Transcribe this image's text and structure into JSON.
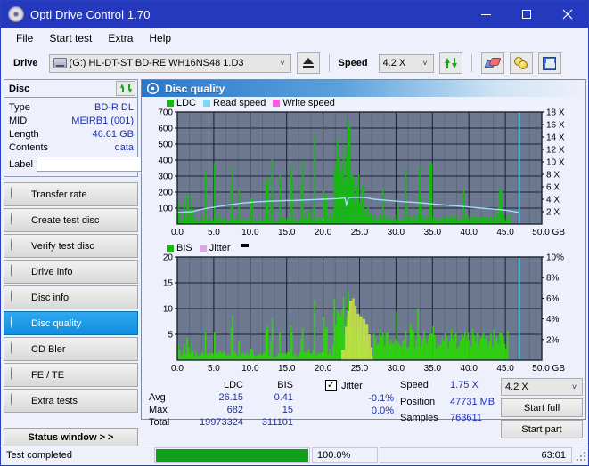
{
  "window": {
    "title": "Opti Drive Control 1.70",
    "icon": "disc-icon",
    "minimize_label": "–",
    "maximize_label": "□",
    "close_label": "×"
  },
  "menubar": {
    "items": [
      {
        "label": "File"
      },
      {
        "label": "Start test"
      },
      {
        "label": "Extra"
      },
      {
        "label": "Help"
      }
    ]
  },
  "toolbar": {
    "drive_label": "Drive",
    "drive_value": "(G:)  HL-DT-ST BD-RE  WH16NS48 1.D3",
    "eject_icon": "eject-icon",
    "speed_label": "Speed",
    "speed_value": "4.2 X",
    "refresh_icon": "refresh-icon",
    "erase_icon": "eraser-icon",
    "coins_icon": "coins-icon",
    "save_icon": "save-icon",
    "chevron": "˅"
  },
  "disc_panel": {
    "title": "Disc",
    "refresh_icon": "refresh-icon",
    "rows": [
      {
        "key": "Type",
        "value": "BD-R DL"
      },
      {
        "key": "MID",
        "value": "MEIRB1 (001)"
      },
      {
        "key": "Length",
        "value": "46.61 GB"
      },
      {
        "key": "Contents",
        "value": "data"
      }
    ],
    "label_key": "Label",
    "label_value": "",
    "label_placeholder": "",
    "label_button_icon": "disc-icon"
  },
  "sidebar": {
    "items": [
      {
        "label": "Transfer rate",
        "icon": "disc-icon",
        "selected": false
      },
      {
        "label": "Create test disc",
        "icon": "disc-icon",
        "selected": false
      },
      {
        "label": "Verify test disc",
        "icon": "disc-icon",
        "selected": false
      },
      {
        "label": "Drive info",
        "icon": "disc-icon",
        "selected": false
      },
      {
        "label": "Disc info",
        "icon": "disc-icon",
        "selected": false
      },
      {
        "label": "Disc quality",
        "icon": "disc-icon",
        "selected": true
      },
      {
        "label": "CD Bler",
        "icon": "disc-icon",
        "selected": false
      },
      {
        "label": "FE / TE",
        "icon": "disc-icon",
        "selected": false
      },
      {
        "label": "Extra tests",
        "icon": "disc-icon",
        "selected": false
      }
    ],
    "status_window_label": "Status window > >"
  },
  "panel": {
    "title": "Disc quality",
    "icon": "disc-icon"
  },
  "stats": {
    "col_headers": [
      "LDC",
      "BIS"
    ],
    "rows": [
      {
        "label": "Avg",
        "ldc": "26.15",
        "bis": "0.41",
        "jitter": "-0.1%"
      },
      {
        "label": "Max",
        "ldc": "682",
        "bis": "15",
        "jitter": "0.0%"
      },
      {
        "label": "Total",
        "ldc": "19973324",
        "bis": "311101",
        "jitter": ""
      }
    ],
    "jitter_label": "Jitter",
    "jitter_checked": true,
    "jitter_check_glyph": "✓",
    "speed_label": "Speed",
    "speed_value": "1.75 X",
    "position_label": "Position",
    "position_value": "47731 MB",
    "samples_label": "Samples",
    "samples_value": "763611",
    "speed_select_value": "4.2 X",
    "start_full_label": "Start full",
    "start_part_label": "Start part"
  },
  "statusbar": {
    "message": "Test completed",
    "progress_percent": 100.0,
    "progress_text": "100.0%",
    "elapsed": "63:01"
  },
  "chart_data": [
    {
      "type": "area",
      "name": "ldc-chart",
      "title": "Disc quality",
      "xlabel": "GB",
      "ylabel": "",
      "xlim": [
        0,
        50
      ],
      "ylim": [
        0,
        700
      ],
      "y2lim": [
        0,
        18
      ],
      "y2label": "X",
      "xticks": [
        "0.0",
        "5.0",
        "10.0",
        "15.0",
        "20.0",
        "25.0",
        "30.0",
        "35.0",
        "40.0",
        "45.0",
        "50.0 GB"
      ],
      "yticks": [
        100,
        200,
        300,
        400,
        500,
        600,
        700
      ],
      "y2ticks": [
        "2 X",
        "4 X",
        "6 X",
        "8 X",
        "10 X",
        "12 X",
        "14 X",
        "16 X",
        "18 X"
      ],
      "grid": true,
      "legend": [
        {
          "name": "LDC",
          "color": "#17b814"
        },
        {
          "name": "Read speed",
          "color": "#7fd6f5"
        },
        {
          "name": "Write speed",
          "color": "#ff5ce0"
        }
      ],
      "plot_bg": "#6d7991",
      "data_end_gb": 46.9,
      "series": [
        {
          "name": "LDC",
          "color": "#17b814",
          "x": [
            0.0,
            0.3,
            0.6,
            0.9,
            1.2,
            1.5,
            1.8,
            2.1,
            2.4,
            2.7,
            3.0,
            3.3,
            3.6,
            3.9,
            4.2,
            4.5,
            4.8,
            5.1,
            5.4,
            5.7,
            6.0,
            6.3,
            6.6,
            6.9,
            7.2,
            7.5,
            7.8,
            8.1,
            8.4,
            8.7,
            9.0,
            9.3,
            9.6,
            9.9,
            10.2,
            10.5,
            10.8,
            11.1,
            11.4,
            11.7,
            12.0,
            12.3,
            12.6,
            12.9,
            13.2,
            13.5,
            13.8,
            14.1,
            14.4,
            14.7,
            15.0,
            15.3,
            15.6,
            15.9,
            16.2,
            16.5,
            16.8,
            17.1,
            17.4,
            17.7,
            18.0,
            18.3,
            18.6,
            18.9,
            19.2,
            19.5,
            19.8,
            20.1,
            20.4,
            20.7,
            21.0,
            21.3,
            21.6,
            21.9,
            22.2,
            22.5,
            22.8,
            23.1,
            23.4,
            23.7,
            24.0,
            24.3,
            24.6,
            24.9,
            25.2,
            25.5,
            25.8,
            26.1,
            26.4,
            26.7,
            27.0,
            27.3,
            27.6,
            27.9,
            28.2,
            28.5,
            28.8,
            29.1,
            29.4,
            29.7,
            30.0,
            30.3,
            30.6,
            30.9,
            31.2,
            31.5,
            31.8,
            32.1,
            32.4,
            32.7,
            33.0,
            33.3,
            33.6,
            33.9,
            34.2,
            34.5,
            34.8,
            35.1,
            35.4,
            35.7,
            36.0,
            36.3,
            36.6,
            36.9,
            37.2,
            37.5,
            37.8,
            38.1,
            38.4,
            38.7,
            39.0,
            39.3,
            39.6,
            39.9,
            40.2,
            40.5,
            40.8,
            41.1,
            41.4,
            41.7,
            42.0,
            42.3,
            42.6,
            42.9,
            43.2,
            43.5,
            43.8,
            44.1,
            44.4,
            44.7,
            45.0,
            45.3,
            45.6,
            45.9,
            46.2,
            46.5,
            46.8
          ],
          "y": [
            400,
            70,
            40,
            240,
            60,
            230,
            55,
            250,
            45,
            30,
            35,
            40,
            30,
            390,
            45,
            30,
            25,
            385,
            40,
            60,
            30,
            35,
            45,
            30,
            40,
            330,
            35,
            45,
            330,
            30,
            40,
            45,
            30,
            55,
            360,
            50,
            35,
            40,
            30,
            45,
            30,
            300,
            50,
            420,
            40,
            35,
            30,
            330,
            45,
            55,
            40,
            30,
            385,
            45,
            30,
            40,
            35,
            385,
            30,
            45,
            120,
            40,
            250,
            580,
            40,
            50,
            35,
            200,
            170,
            45,
            80,
            90,
            330,
            520,
            690,
            420,
            470,
            530,
            610,
            560,
            420,
            350,
            300,
            280,
            250,
            230,
            200,
            130,
            90,
            70,
            60,
            55,
            50,
            45,
            230,
            50,
            40,
            45,
            50,
            40,
            45,
            200,
            40,
            35,
            50,
            340,
            45,
            40,
            50,
            35,
            60,
            420,
            55,
            45,
            40,
            60,
            420,
            45,
            35,
            40,
            50,
            45,
            40,
            60,
            45,
            40,
            35,
            50,
            45,
            60,
            40,
            280,
            50,
            45,
            40,
            35,
            55,
            45,
            50,
            40,
            45,
            60,
            50,
            45,
            40,
            35,
            130,
            200,
            230,
            90,
            60,
            45,
            70
          ]
        },
        {
          "name": "Read speed",
          "color": "#9fdcf7",
          "x": [
            0.0,
            1.0,
            2.0,
            3.0,
            4.0,
            5.0,
            6.0,
            7.0,
            8.0,
            9.0,
            10.0,
            11.0,
            12.0,
            13.0,
            14.0,
            15.0,
            16.0,
            17.0,
            18.0,
            19.0,
            20.0,
            21.0,
            22.0,
            23.0,
            23.2,
            23.5,
            24.0,
            25.0,
            26.0,
            26.5,
            27.0,
            28.0,
            29.0,
            30.0,
            31.0,
            32.0,
            33.0,
            34.0,
            35.0,
            36.0,
            37.0,
            38.0,
            39.0,
            40.0,
            41.0,
            42.0,
            43.0,
            44.0,
            45.0,
            46.0,
            46.9
          ],
          "y": [
            1.85,
            1.95,
            2.0,
            2.3,
            2.55,
            2.7,
            2.9,
            3.1,
            3.25,
            3.4,
            3.5,
            3.6,
            3.65,
            3.7,
            3.75,
            3.8,
            3.8,
            3.85,
            3.9,
            3.95,
            4.0,
            4.05,
            4.1,
            4.2,
            3.1,
            4.25,
            4.3,
            4.3,
            4.25,
            4.1,
            4.0,
            3.9,
            3.8,
            3.7,
            3.6,
            3.55,
            3.45,
            3.35,
            3.25,
            3.15,
            3.05,
            2.95,
            2.85,
            2.75,
            2.65,
            2.55,
            2.45,
            2.35,
            2.25,
            2.05,
            1.9
          ]
        }
      ],
      "cursor_gb": 46.9,
      "cursor_color": "#46d9f0"
    },
    {
      "type": "area",
      "name": "bis-chart",
      "title": "",
      "xlabel": "GB",
      "ylabel": "",
      "xlim": [
        0,
        50
      ],
      "ylim": [
        0,
        20
      ],
      "y2lim": [
        0,
        10
      ],
      "y2label": "%",
      "xticks": [
        "0.0",
        "5.0",
        "10.0",
        "15.0",
        "20.0",
        "25.0",
        "30.0",
        "35.0",
        "40.0",
        "45.0",
        "50.0 GB"
      ],
      "yticks": [
        5,
        10,
        15,
        20
      ],
      "y2ticks": [
        "2%",
        "4%",
        "6%",
        "8%",
        "10%"
      ],
      "grid": true,
      "legend": [
        {
          "name": "BIS",
          "color": "#17b814"
        },
        {
          "name": "Jitter",
          "color": "#d9a8e0"
        }
      ],
      "plot_bg": "#6d7991",
      "data_end_gb": 46.9,
      "series": [
        {
          "name": "BIS",
          "color": "#2fd010",
          "x": [
            0.0,
            0.3,
            0.6,
            0.9,
            1.2,
            1.5,
            1.8,
            2.1,
            2.4,
            2.7,
            3.0,
            3.3,
            3.6,
            3.9,
            4.2,
            4.5,
            4.8,
            5.1,
            5.4,
            5.7,
            6.0,
            6.3,
            6.6,
            6.9,
            7.2,
            7.5,
            7.8,
            8.1,
            8.4,
            8.7,
            9.0,
            9.3,
            9.6,
            9.9,
            10.2,
            10.5,
            10.8,
            11.1,
            11.4,
            11.7,
            12.0,
            12.3,
            12.6,
            12.9,
            13.2,
            13.5,
            13.8,
            14.1,
            14.4,
            14.7,
            15.0,
            15.3,
            15.6,
            15.9,
            16.2,
            16.5,
            16.8,
            17.1,
            17.4,
            17.7,
            18.0,
            18.3,
            18.6,
            18.9,
            19.2,
            19.5,
            19.8,
            20.1,
            20.4,
            20.7,
            21.0,
            21.3,
            21.6,
            21.9,
            22.2,
            22.5,
            22.8,
            23.1,
            23.4,
            23.7,
            24.0,
            24.3,
            24.6,
            24.9,
            25.2,
            25.5,
            25.8,
            26.1,
            26.4,
            26.7,
            27.0,
            27.3,
            27.6,
            27.9,
            28.2,
            28.5,
            28.8,
            29.1,
            29.4,
            29.7,
            30.0,
            30.3,
            30.6,
            30.9,
            31.2,
            31.5,
            31.8,
            32.1,
            32.4,
            32.7,
            33.0,
            33.3,
            33.6,
            33.9,
            34.2,
            34.5,
            34.8,
            35.1,
            35.4,
            35.7,
            36.0,
            36.3,
            36.6,
            36.9,
            37.2,
            37.5,
            37.8,
            38.1,
            38.4,
            38.7,
            39.0,
            39.3,
            39.6,
            39.9,
            40.2,
            40.5,
            40.8,
            41.1,
            41.4,
            41.7,
            42.0,
            42.3,
            42.6,
            42.9,
            43.2,
            43.5,
            43.8,
            44.1,
            44.4,
            44.7,
            45.0,
            45.3,
            45.6,
            45.9,
            46.2,
            46.5,
            46.8
          ],
          "y": [
            9.0,
            2.0,
            1.3,
            5.0,
            1.5,
            5.3,
            1.4,
            4.7,
            1.2,
            1.0,
            1.1,
            1.3,
            1.0,
            6.5,
            1.4,
            1.0,
            0.9,
            5.5,
            1.2,
            1.6,
            1.0,
            1.1,
            1.4,
            1.0,
            1.2,
            8.0,
            1.1,
            1.4,
            5.5,
            1.0,
            1.2,
            1.4,
            1.0,
            1.6,
            5.0,
            1.5,
            1.1,
            1.2,
            1.0,
            1.4,
            1.0,
            6.8,
            1.5,
            8.3,
            1.2,
            1.1,
            1.0,
            6.0,
            1.4,
            1.7,
            1.2,
            1.0,
            7.0,
            1.4,
            1.0,
            1.2,
            1.1,
            6.0,
            1.0,
            1.4,
            3.0,
            1.2,
            5.0,
            12.2,
            1.2,
            1.5,
            1.1,
            8.0,
            6.0,
            1.4,
            2.5,
            2.8,
            12.2,
            9.5,
            15.1,
            11.0,
            11.5,
            10.0,
            12.5,
            10.5,
            9.0,
            8.0,
            7.0,
            6.0,
            5.5,
            5.0,
            4.5,
            3.5,
            2.8,
            2.4,
            2.2,
            2.0,
            5.0,
            4.5,
            5.5,
            4.3,
            4.2,
            4.5,
            5.0,
            4.0,
            9.0,
            4.8,
            4.2,
            4.5,
            4.8,
            4.0,
            4.5,
            8.0,
            4.3,
            4.2,
            11.0,
            4.8,
            4.5,
            4.2,
            4.8,
            4.5,
            4.2,
            9.0,
            4.5,
            4.3,
            4.2,
            4.8,
            4.5,
            4.2,
            5.5,
            4.5,
            4.0,
            4.2,
            4.8,
            4.5,
            9.0,
            4.2,
            4.5,
            4.0,
            4.3,
            5.0,
            4.5,
            4.2,
            4.0,
            4.5,
            5.5,
            4.8,
            4.2,
            4.0,
            4.3,
            5.0,
            8.0,
            5.5,
            4.0,
            4.5,
            4.2,
            5.0
          ]
        },
        {
          "name": "Jitter",
          "color": "#c8e24a",
          "x": [
            22.0,
            22.5,
            23.0,
            23.3,
            23.6,
            24.0,
            24.3,
            24.6,
            25.0,
            25.4,
            25.8,
            26.2,
            26.5,
            26.8
          ],
          "y": [
            0.0,
            2.0,
            6.5,
            9.5,
            11.5,
            12.0,
            10.5,
            9.0,
            8.5,
            8.0,
            7.0,
            5.0,
            2.5,
            0.0
          ]
        }
      ],
      "cursor_gb": 46.9,
      "cursor_color": "#46d9f0"
    }
  ]
}
